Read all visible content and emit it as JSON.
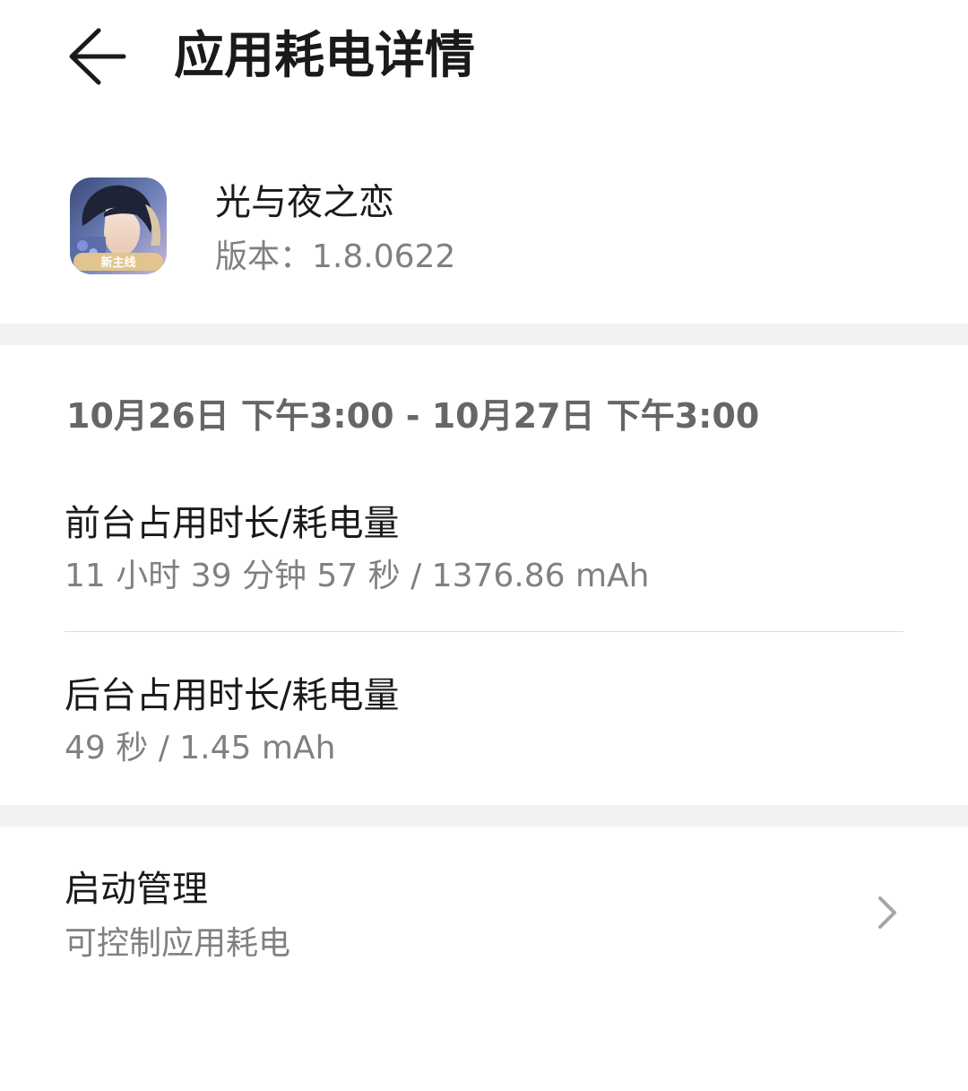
{
  "header": {
    "title": "应用耗电详情",
    "back_icon": "arrow-left-icon"
  },
  "app": {
    "name": "光与夜之恋",
    "version": "版本：1.8.0622",
    "icon": "app-icon",
    "icon_badge": "新主线"
  },
  "period": {
    "range": "10月26日 下午3:00 - 10月27日 下午3:00"
  },
  "foreground": {
    "title": "前台占用时长/耗电量",
    "value": "11 小时 39 分钟 57 秒 / 1376.86 mAh"
  },
  "background": {
    "title": "后台占用时长/耗电量",
    "value": "49 秒 / 1.45 mAh"
  },
  "launch": {
    "title": "启动管理",
    "subtitle": "可控制应用耗电",
    "icon": "chevron-right-icon"
  },
  "colors": {
    "band": "#f2f2f2",
    "primary_text": "#1a1a1a",
    "secondary_text": "#808080"
  }
}
